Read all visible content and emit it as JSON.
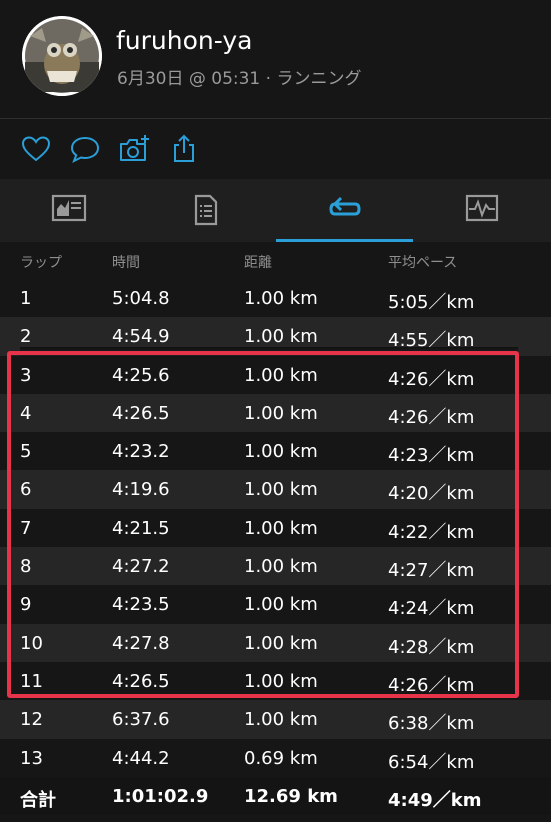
{
  "header": {
    "username": "furuhon-ya",
    "subtitle": "6月30日 @ 05:31 · ランニング"
  },
  "colors": {
    "accent": "#2a9fd8",
    "highlight": "#e8344a"
  },
  "actions": [
    {
      "icon": "heart-icon"
    },
    {
      "icon": "comment-icon"
    },
    {
      "icon": "add-photo-icon"
    },
    {
      "icon": "share-icon"
    }
  ],
  "tabs": [
    {
      "icon": "chart-icon",
      "active": false
    },
    {
      "icon": "document-list-icon",
      "active": false
    },
    {
      "icon": "laps-icon",
      "active": true
    },
    {
      "icon": "graph-icon",
      "active": false
    }
  ],
  "table": {
    "headers": [
      "ラップ",
      "時間",
      "距離",
      "平均ペース"
    ],
    "rows": [
      [
        "1",
        "5:04.8",
        "1.00 km",
        "5:05／km"
      ],
      [
        "2",
        "4:54.9",
        "1.00 km",
        "4:55／km"
      ],
      [
        "3",
        "4:25.6",
        "1.00 km",
        "4:26／km"
      ],
      [
        "4",
        "4:26.5",
        "1.00 km",
        "4:26／km"
      ],
      [
        "5",
        "4:23.2",
        "1.00 km",
        "4:23／km"
      ],
      [
        "6",
        "4:19.6",
        "1.00 km",
        "4:20／km"
      ],
      [
        "7",
        "4:21.5",
        "1.00 km",
        "4:22／km"
      ],
      [
        "8",
        "4:27.2",
        "1.00 km",
        "4:27／km"
      ],
      [
        "9",
        "4:23.5",
        "1.00 km",
        "4:24／km"
      ],
      [
        "10",
        "4:27.8",
        "1.00 km",
        "4:28／km"
      ],
      [
        "11",
        "4:26.5",
        "1.00 km",
        "4:26／km"
      ],
      [
        "12",
        "6:37.6",
        "1.00 km",
        "6:38／km"
      ],
      [
        "13",
        "4:44.2",
        "0.69 km",
        "6:54／km"
      ]
    ],
    "total": [
      "合計",
      "1:01:02.9",
      "12.69 km",
      "4:49／km"
    ]
  }
}
